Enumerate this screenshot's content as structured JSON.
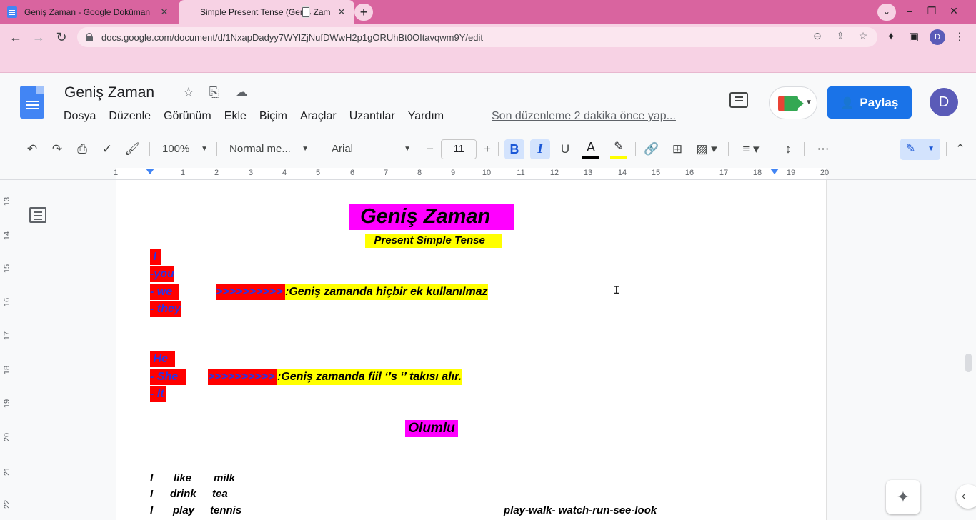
{
  "browser": {
    "tabs": [
      {
        "title": "Geniş Zaman - Google Doküman",
        "active": false
      },
      {
        "title": "Simple Present Tense (Geniş Zam",
        "active": true
      }
    ],
    "new_tab": "+",
    "url": "docs.google.com/document/d/1NxapDadyy7WYlZjNufDWwH2p1gORUhBt0OItavqwm9Y/edit",
    "profile_initial": "D"
  },
  "docs": {
    "title": "Geniş Zaman",
    "menu": [
      "Dosya",
      "Düzenle",
      "Görünüm",
      "Ekle",
      "Biçim",
      "Araçlar",
      "Uzantılar",
      "Yardım"
    ],
    "last_edit": "Son düzenleme 2 dakika önce yap...",
    "share_label": "Paylaş",
    "avatar_initial": "D"
  },
  "toolbar": {
    "zoom": "100%",
    "style": "Normal me...",
    "font": "Arial",
    "font_size": "11",
    "bold": "B",
    "italic": "I",
    "underline": "U",
    "text_color": "A"
  },
  "ruler": {
    "numbers": [
      "1",
      "1",
      "2",
      "3",
      "4",
      "5",
      "6",
      "7",
      "8",
      "9",
      "10",
      "11",
      "12",
      "13",
      "14",
      "15",
      "16",
      "17",
      "18",
      "19",
      "20"
    ],
    "vertical": [
      "13",
      "14",
      "15",
      "16",
      "17",
      "18",
      "19",
      "20",
      "21",
      "22"
    ]
  },
  "content": {
    "heading": "  Geniş Zaman",
    "subheading": "   Present Simple Tense",
    "group1": [
      " I",
      "-you",
      "- we",
      "- they"
    ],
    "arrow1": ">>>>>>>>>>",
    "rule1": ":Geniş zamanda hiçbir ek kullanılmaz",
    "group2": [
      " He",
      "- She",
      "- It"
    ],
    "arrow2": ">>>>>>>>>>",
    "rule2": ":Geniş zamanda fiil ‘’s ‘’ takısı alır.",
    "olumlu": "Olumlu",
    "examples": [
      {
        "s": "I",
        "v": "like",
        "o": "milk"
      },
      {
        "s": "I",
        "v": "drink",
        "o": "tea"
      },
      {
        "s": "I",
        "v": "play",
        "o": "tennis"
      }
    ],
    "verbs": "play-walk- watch-run-see-look"
  },
  "colors": {
    "tab_strip": "#d9649f",
    "toolbar": "#f7d2e4",
    "accent": "#1a73e8",
    "highlight_magenta": "#ff00ff",
    "highlight_yellow": "#ffff00",
    "highlight_red": "#ff0000",
    "text_blue": "#2a34e6"
  }
}
